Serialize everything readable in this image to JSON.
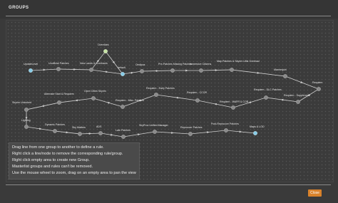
{
  "window": {
    "title": "GROUPS"
  },
  "graph": {
    "nodes": [
      {
        "id": "updatelevel",
        "label": "UpdateLevel",
        "kind": "blue"
      },
      {
        "id": "unofficial-patches",
        "label": "Unofficial Patches",
        "kind": "normal"
      },
      {
        "id": "new-lands",
        "label": "New Lands & Overhauls",
        "kind": "normal"
      },
      {
        "id": "overrides",
        "label": "Overrides",
        "kind": "green"
      },
      {
        "id": "default",
        "label": "default",
        "kind": "blue"
      },
      {
        "id": "outfit",
        "label": "Oedipus",
        "kind": "normal"
      },
      {
        "id": "pre-patches",
        "label": "Pre-Patches Missing Patches",
        "kind": "normal"
      },
      {
        "id": "immersive-citizens",
        "label": "Immersive Citizens",
        "kind": "normal"
      },
      {
        "id": "map-patches",
        "label": "Map Patches & Skyrim Utils Overhaul",
        "kind": "normal"
      },
      {
        "id": "mannequin",
        "label": "Mannequin",
        "kind": "normal"
      },
      {
        "id": "requiem",
        "label": "Requiem",
        "kind": "normal"
      },
      {
        "id": "requiem-dlc",
        "label": "Requiem - DLC Patches",
        "kind": "normal"
      },
      {
        "id": "requiem-supplement",
        "label": "Requiem - Supplement",
        "kind": "normal"
      },
      {
        "id": "requiem-early",
        "label": "Requiem - Early Patches",
        "kind": "normal"
      },
      {
        "id": "requiem-ccor",
        "label": "Requiem - CCOR",
        "kind": "normal"
      },
      {
        "id": "requiem-wafr",
        "label": "Requiem - WAFR & COR",
        "kind": "normal"
      },
      {
        "id": "requiem-misc",
        "label": "Requiem - Misc. Patches",
        "kind": "normal"
      },
      {
        "id": "open-cities",
        "label": "Open Cities Skyrim",
        "kind": "normal"
      },
      {
        "id": "alternate-start",
        "label": "Alternate Start & Requiem",
        "kind": "normal"
      },
      {
        "id": "skyrim-unlocked",
        "label": "Skyrim Unlocked",
        "kind": "normal"
      },
      {
        "id": "lighting",
        "label": "Lighting",
        "kind": "normal"
      },
      {
        "id": "dynamic-patches",
        "label": "Dynamic Patches",
        "kind": "normal"
      },
      {
        "id": "sky-matters",
        "label": "Sky Matters",
        "kind": "normal"
      },
      {
        "id": "ads",
        "label": "ADS",
        "kind": "normal"
      },
      {
        "id": "late-patches",
        "label": "Late Patches",
        "kind": "normal"
      },
      {
        "id": "skyproc",
        "label": "SkyProc Unified Manager",
        "kind": "normal"
      },
      {
        "id": "reproccer",
        "label": "Reproccer Patches",
        "kind": "normal"
      },
      {
        "id": "post-reproccer",
        "label": "Post-Reproccer Patches",
        "kind": "normal"
      },
      {
        "id": "maps-lod",
        "label": "Maps & LOD",
        "kind": "blue"
      }
    ]
  },
  "help": {
    "lines": [
      "Drag line from one group to another to define a rule.",
      "Right click a line/node to remove the corresponding rule/group.",
      "Right click empty area to create new Group.",
      "Masterlist groups and rules can't be removed.",
      "Use the mouse wheel to zoom, drag on an empty area to pan the view"
    ]
  },
  "footer": {
    "close_label": "Close"
  },
  "colors": {
    "accent": "#d9822b",
    "node_blue": "#86cbe6",
    "node_green": "#c6e3a4",
    "node_gray": "#8a8a8a"
  }
}
